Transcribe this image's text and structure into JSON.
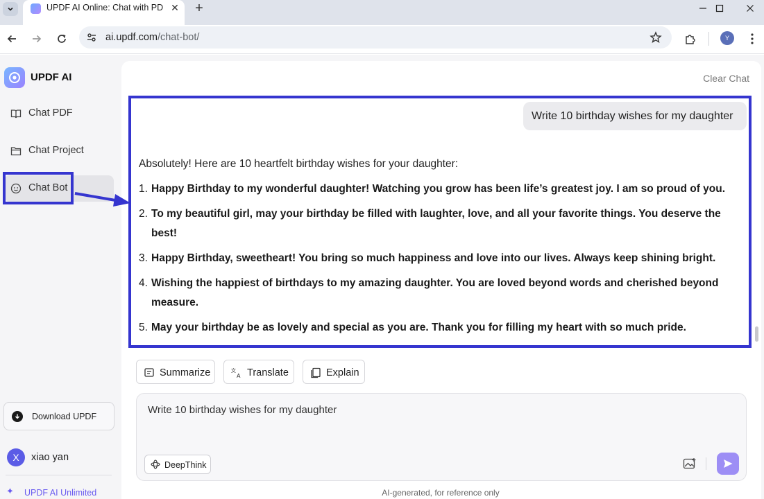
{
  "browser": {
    "tab_title": "UPDF AI Online: Chat with PDF",
    "url_host": "ai.updf.com",
    "url_path": "/chat-bot/",
    "profile_initial": "Y"
  },
  "sidebar": {
    "logo_text": "UPDF AI",
    "items": [
      {
        "label": "Chat PDF",
        "icon": "book-open-icon"
      },
      {
        "label": "Chat Project",
        "icon": "folder-icon"
      },
      {
        "label": "Chat Bot",
        "icon": "bot-face-icon"
      }
    ],
    "download_label": "Download UPDF",
    "user_initial": "X",
    "user_name": "xiao yan",
    "unlimited_label": "UPDF AI Unlimited"
  },
  "chat": {
    "clear_label": "Clear Chat",
    "user_message": "Write 10 birthday wishes for my daughter",
    "answer_intro": "Absolutely! Here are 10 heartfelt birthday wishes for your daughter:",
    "wishes": [
      {
        "num": "1.",
        "text": "Happy Birthday to my wonderful daughter! Watching you grow has been life’s greatest joy. I am so proud of you."
      },
      {
        "num": "2.",
        "text": "To my beautiful girl, may your birthday be filled with laughter, love, and all your favorite things. You deserve the best!"
      },
      {
        "num": "3.",
        "text": "Happy Birthday, sweetheart! You bring so much happiness and love into our lives. Always keep shining bright."
      },
      {
        "num": "4.",
        "text": "Wishing the happiest of birthdays to my amazing daughter. You are loved beyond words and cherished beyond measure."
      },
      {
        "num": "5.",
        "text": "May your birthday be as lovely and special as you are. Thank you for filling my heart with so much pride."
      }
    ],
    "actions": [
      {
        "label": "Summarize",
        "icon": "summarize-icon"
      },
      {
        "label": "Translate",
        "icon": "translate-icon"
      },
      {
        "label": "Explain",
        "icon": "explain-icon"
      }
    ],
    "composer_value": "Write 10 birthday wishes for my daughter",
    "deepthink_label": "DeepThink",
    "disclaimer": "AI-generated, for reference only"
  },
  "colors": {
    "annotation": "#3535cf",
    "accent": "#9d8ef5",
    "brand_purple": "#6a5cf0"
  }
}
